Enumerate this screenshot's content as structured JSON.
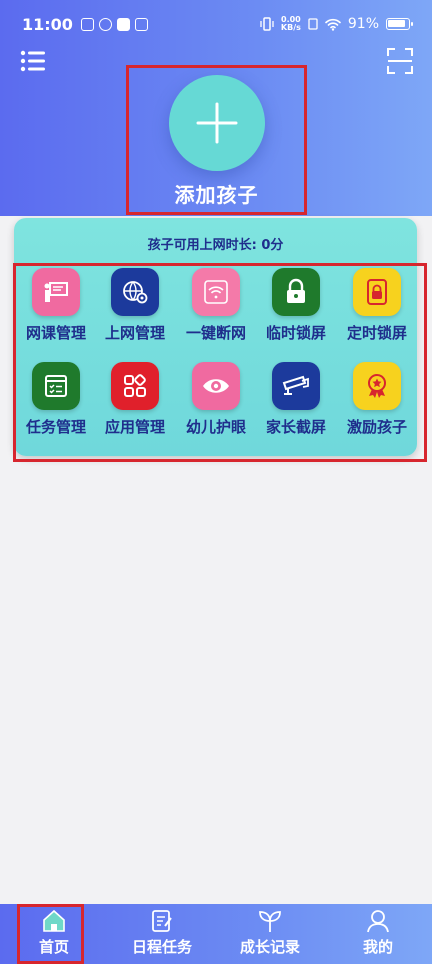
{
  "status_bar": {
    "time": "11:00",
    "net_speed_top": "0.00",
    "net_speed_bottom": "KB/s",
    "battery": "91%"
  },
  "header": {
    "add_child_label": "添加孩子",
    "menu_icon": "hamburger-menu-icon",
    "scan_icon": "scan-icon"
  },
  "panel": {
    "usage_text": "孩子可用上网时长: 0分",
    "tiles": [
      {
        "label": "网课管理",
        "icon": "online-class-icon",
        "color": "#f06aa0"
      },
      {
        "label": "上网管理",
        "icon": "globe-settings-icon",
        "color": "#1c3a9c"
      },
      {
        "label": "一键断网",
        "icon": "wifi-off-icon",
        "color": "#f47aa9"
      },
      {
        "label": "临时锁屏",
        "icon": "lock-icon",
        "color": "#1f7a2c"
      },
      {
        "label": "定时锁屏",
        "icon": "timed-lock-icon",
        "color": "#f7d21e"
      },
      {
        "label": "任务管理",
        "icon": "task-list-icon",
        "color": "#1f7a2c"
      },
      {
        "label": "应用管理",
        "icon": "apps-icon",
        "color": "#e0202b"
      },
      {
        "label": "幼儿护眼",
        "icon": "eye-icon",
        "color": "#f06aa0"
      },
      {
        "label": "家长截屏",
        "icon": "camera-icon",
        "color": "#1c3a9c"
      },
      {
        "label": "激励孩子",
        "icon": "medal-icon",
        "color": "#f7d21e"
      }
    ]
  },
  "tabbar": {
    "tabs": [
      {
        "label": "首页",
        "icon": "home-icon"
      },
      {
        "label": "日程任务",
        "icon": "schedule-icon"
      },
      {
        "label": "成长记录",
        "icon": "sprout-icon"
      },
      {
        "label": "我的",
        "icon": "profile-icon"
      }
    ]
  },
  "colors": {
    "header_blue": "#5b6bef",
    "panel_teal": "#7fe4df",
    "highlight_red": "#d7262e",
    "text_navy": "#1f2e8c"
  }
}
